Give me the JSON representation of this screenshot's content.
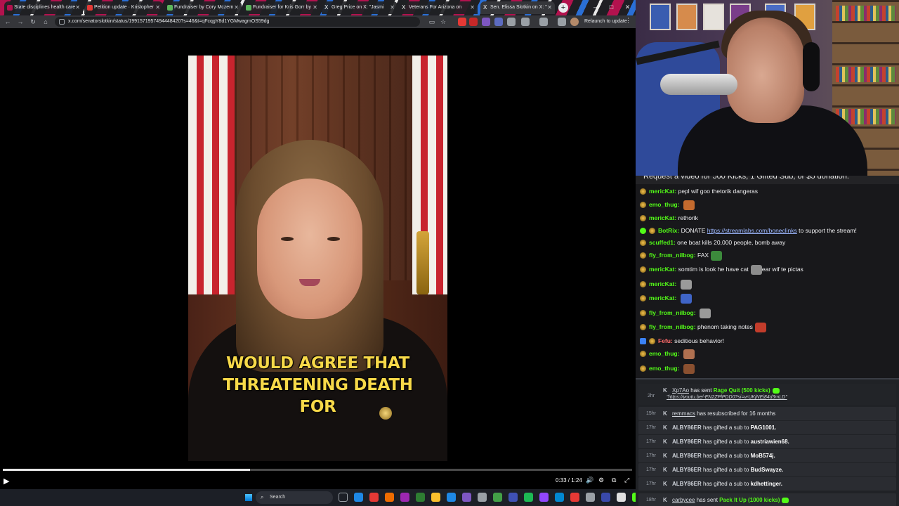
{
  "browser": {
    "tabs": [
      {
        "label": "State disciplines health care",
        "favicon_color": "#b3124e"
      },
      {
        "label": "Petition update · Kristopher",
        "favicon_color": "#e53935"
      },
      {
        "label": "Fundraiser by Cory Mczern",
        "favicon_color": "#5cb85c"
      },
      {
        "label": "Fundraiser for Kris Gorr by",
        "favicon_color": "#5cb85c"
      },
      {
        "label": "Greg Price on X: \"Jasmi",
        "favicon_color": "#ffffff"
      },
      {
        "label": "Veterans For Arizona on",
        "favicon_color": "#ffffff"
      },
      {
        "label": "Sen. Elissa Slotkin on X: \"",
        "favicon_color": "#ffffff"
      }
    ],
    "new_tab": "+",
    "window_controls": {
      "minimize": "–",
      "maximize": "□",
      "close": "✕"
    },
    "url": "x.com/senatorslotkin/status/1991571957494448420?s=46&t=qFcqgY8d1YGMwagmOS59dg",
    "relaunch_label": "Relaunch to update",
    "nav": {
      "back": "←",
      "forward": "→",
      "reload": "↻",
      "home": "⌂",
      "star": "☆",
      "kebab": "⋮"
    }
  },
  "video": {
    "caption_lines": [
      "WOULD AGREE THAT",
      "THREATENING DEATH",
      "FOR"
    ],
    "time_display": "0:33 / 1:24",
    "progress": 0.393,
    "controls": {
      "play": "▶",
      "volume": "🔊",
      "settings": "⚙",
      "pip": "⧉",
      "fullscreen": "⤢"
    }
  },
  "taskbar": {
    "search_placeholder": "Search",
    "app_colors": [
      "#9aa0a6",
      "#1e88e5",
      "#e53935",
      "#ef6c00",
      "#9c27b0",
      "#2e7d32",
      "#fbc02d",
      "#1e88e5",
      "#7e57c2",
      "#9aa0a6",
      "#43a047",
      "#3f51b5",
      "#1db954",
      "#9146ff",
      "#0288d1",
      "#e53935",
      "#9aa0a6",
      "#3949ab",
      "#e0e0e0",
      "#53fc18"
    ]
  },
  "chat": {
    "banner": "Request a video for 500 Kicks, 1 Gifted Sub, or $5 donation.",
    "messages": [
      {
        "user": "mericKat",
        "user_color": "#53fc18",
        "text": "pepl wif goo thetorik dangeras",
        "emote": ""
      },
      {
        "user": "emo_thug",
        "user_color": "#53fc18",
        "text": "",
        "emote": "#c46a2e"
      },
      {
        "user": "mericKat",
        "user_color": "#53fc18",
        "text": "rethorik",
        "emote": ""
      },
      {
        "user": "BotRix",
        "user_color": "#53fc18",
        "text": "DONATE ",
        "link": "https://streamlabs.com/boneclinks",
        "after": " to support the stream!",
        "emote": "",
        "badge": "bot"
      },
      {
        "user": "scuffed1",
        "user_color": "#53fc18",
        "text": "one boat kills 20,000 people, bomb away",
        "emote": ""
      },
      {
        "user": "fly_from_nilbog",
        "user_color": "#53fc18",
        "text": "FAX",
        "emote": "#3c8a3c"
      },
      {
        "user": "mericKat",
        "user_color": "#53fc18",
        "text": "somtim is look he have cat",
        "after": "ear wif te pictas",
        "emote": "#8c8c8c"
      },
      {
        "user": "mericKat",
        "user_color": "#53fc18",
        "text": "",
        "emote": "#9a9a9a"
      },
      {
        "user": "mericKat",
        "user_color": "#53fc18",
        "text": "",
        "emote": "#3f64c6"
      },
      {
        "user": "fly_from_nilbog",
        "user_color": "#53fc18",
        "text": "",
        "emote": "#9a9a9a"
      },
      {
        "user": "fly_from_nilbog",
        "user_color": "#53fc18",
        "text": "phenom taking notes",
        "emote": "#c23c2b"
      },
      {
        "user": "Fefu",
        "user_color": "#ff6b6b",
        "text": "seditious behavior!",
        "emote": "",
        "badge": "kick"
      },
      {
        "user": "emo_thug",
        "user_color": "#53fc18",
        "text": "",
        "emote": "#b07050"
      },
      {
        "user": "emo_thug",
        "user_color": "#53fc18",
        "text": "",
        "emote": "#8a5030"
      }
    ]
  },
  "events": [
    {
      "time": "2hr",
      "user": "Xp7Ao",
      "action": "has sent",
      "highlight": "Rage Quit (500 kicks)",
      "link": "https://youtu.be/-EN2ZPlPDD0?si=vrUKjNEj84d3mLD"
    },
    {
      "time": "15hr",
      "user": "remmacs",
      "action": "has resubscribed for 16 months",
      "highlight": ""
    },
    {
      "time": "17hr",
      "user": "ALBY86ER",
      "action": "has gifted a sub to",
      "target": "PAG1001."
    },
    {
      "time": "17hr",
      "user": "ALBY86ER",
      "action": "has gifted a sub to",
      "target": "austriawien68."
    },
    {
      "time": "17hr",
      "user": "ALBY86ER",
      "action": "has gifted a sub to",
      "target": "MoB574j."
    },
    {
      "time": "17hr",
      "user": "ALBY86ER",
      "action": "has gifted a sub to",
      "target": "BudSwayze."
    },
    {
      "time": "17hr",
      "user": "ALBY86ER",
      "action": "has gifted a sub to",
      "target": "kdhettinger."
    },
    {
      "time": "18hr",
      "user": "carbycee",
      "action": "has sent",
      "highlight": "Pack It Up (1000 kicks)"
    }
  ],
  "colors": {
    "accent_green": "#53fc18",
    "caption_yellow": "#f7d949",
    "chat_bg": "#18181b"
  }
}
